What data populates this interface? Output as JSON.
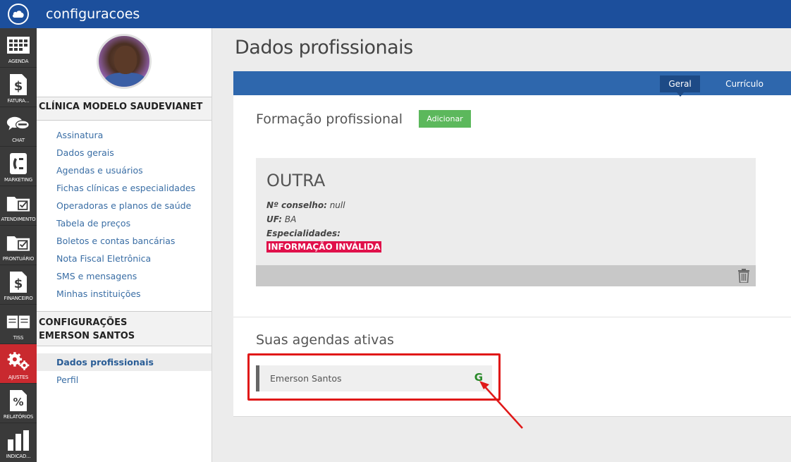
{
  "app": {
    "title": "configuracoes"
  },
  "rail": [
    {
      "label": "AGENDA",
      "icon": "calendar-icon"
    },
    {
      "label": "FATURA...",
      "icon": "dollar-doc-icon"
    },
    {
      "label": "CHAT",
      "icon": "chat-bubbles-icon"
    },
    {
      "label": "MARKETING",
      "icon": "phone-icon"
    },
    {
      "label": "ATENDIMENTO",
      "icon": "folder-check-icon"
    },
    {
      "label": "PRONTUÁRIO",
      "icon": "folder-check-icon"
    },
    {
      "label": "FINANCEIRO",
      "icon": "dollar-doc-icon"
    },
    {
      "label": "TISS",
      "icon": "book-icon"
    },
    {
      "label": "AJUSTES",
      "icon": "gears-icon",
      "active": true
    },
    {
      "label": "RELATÓRIOS",
      "icon": "percent-doc-icon"
    },
    {
      "label": "INDICAD...",
      "icon": "bar-chart-icon"
    }
  ],
  "sidebar": {
    "clinic_heading": "CLÍNICA MODELO SAUDEVIANET",
    "clinic_items": [
      "Assinatura",
      "Dados gerais",
      "Agendas e usuários",
      "Fichas clínicas e especialidades",
      "Operadoras e planos de saúde",
      "Tabela de preços",
      "Boletos e contas bancárias",
      "Nota Fiscal Eletrônica",
      "SMS e mensagens",
      "Minhas instituições"
    ],
    "user_heading_line1": "CONFIGURAÇÕES",
    "user_heading_line2": "EMERSON SANTOS",
    "user_items": [
      "Dados profissionais",
      "Perfil"
    ]
  },
  "main": {
    "page_title": "Dados profissionais",
    "tabs": [
      "Geral",
      "Currículo"
    ],
    "formacao_title": "Formação profissional",
    "add_button": "Adicionar",
    "card": {
      "title": "OUTRA",
      "conselho_label": "Nº conselho:",
      "conselho_value": "null",
      "uf_label": "UF:",
      "uf_value": "BA",
      "especialidades_label": "Especialidades:",
      "invalid_text": "INFORMAÇÃO INVÁLIDA"
    },
    "agendas_title": "Suas agendas ativas",
    "agenda_name": "Emerson Santos",
    "agenda_badge": "G"
  },
  "colors": {
    "topbar": "#1c4f9c",
    "rail": "#3a3a3a",
    "rail_active": "#c9292f",
    "tabbar": "#2e67ad",
    "add_button": "#5cb85c",
    "invalid": "#e0104a",
    "annotation": "#e01818"
  }
}
